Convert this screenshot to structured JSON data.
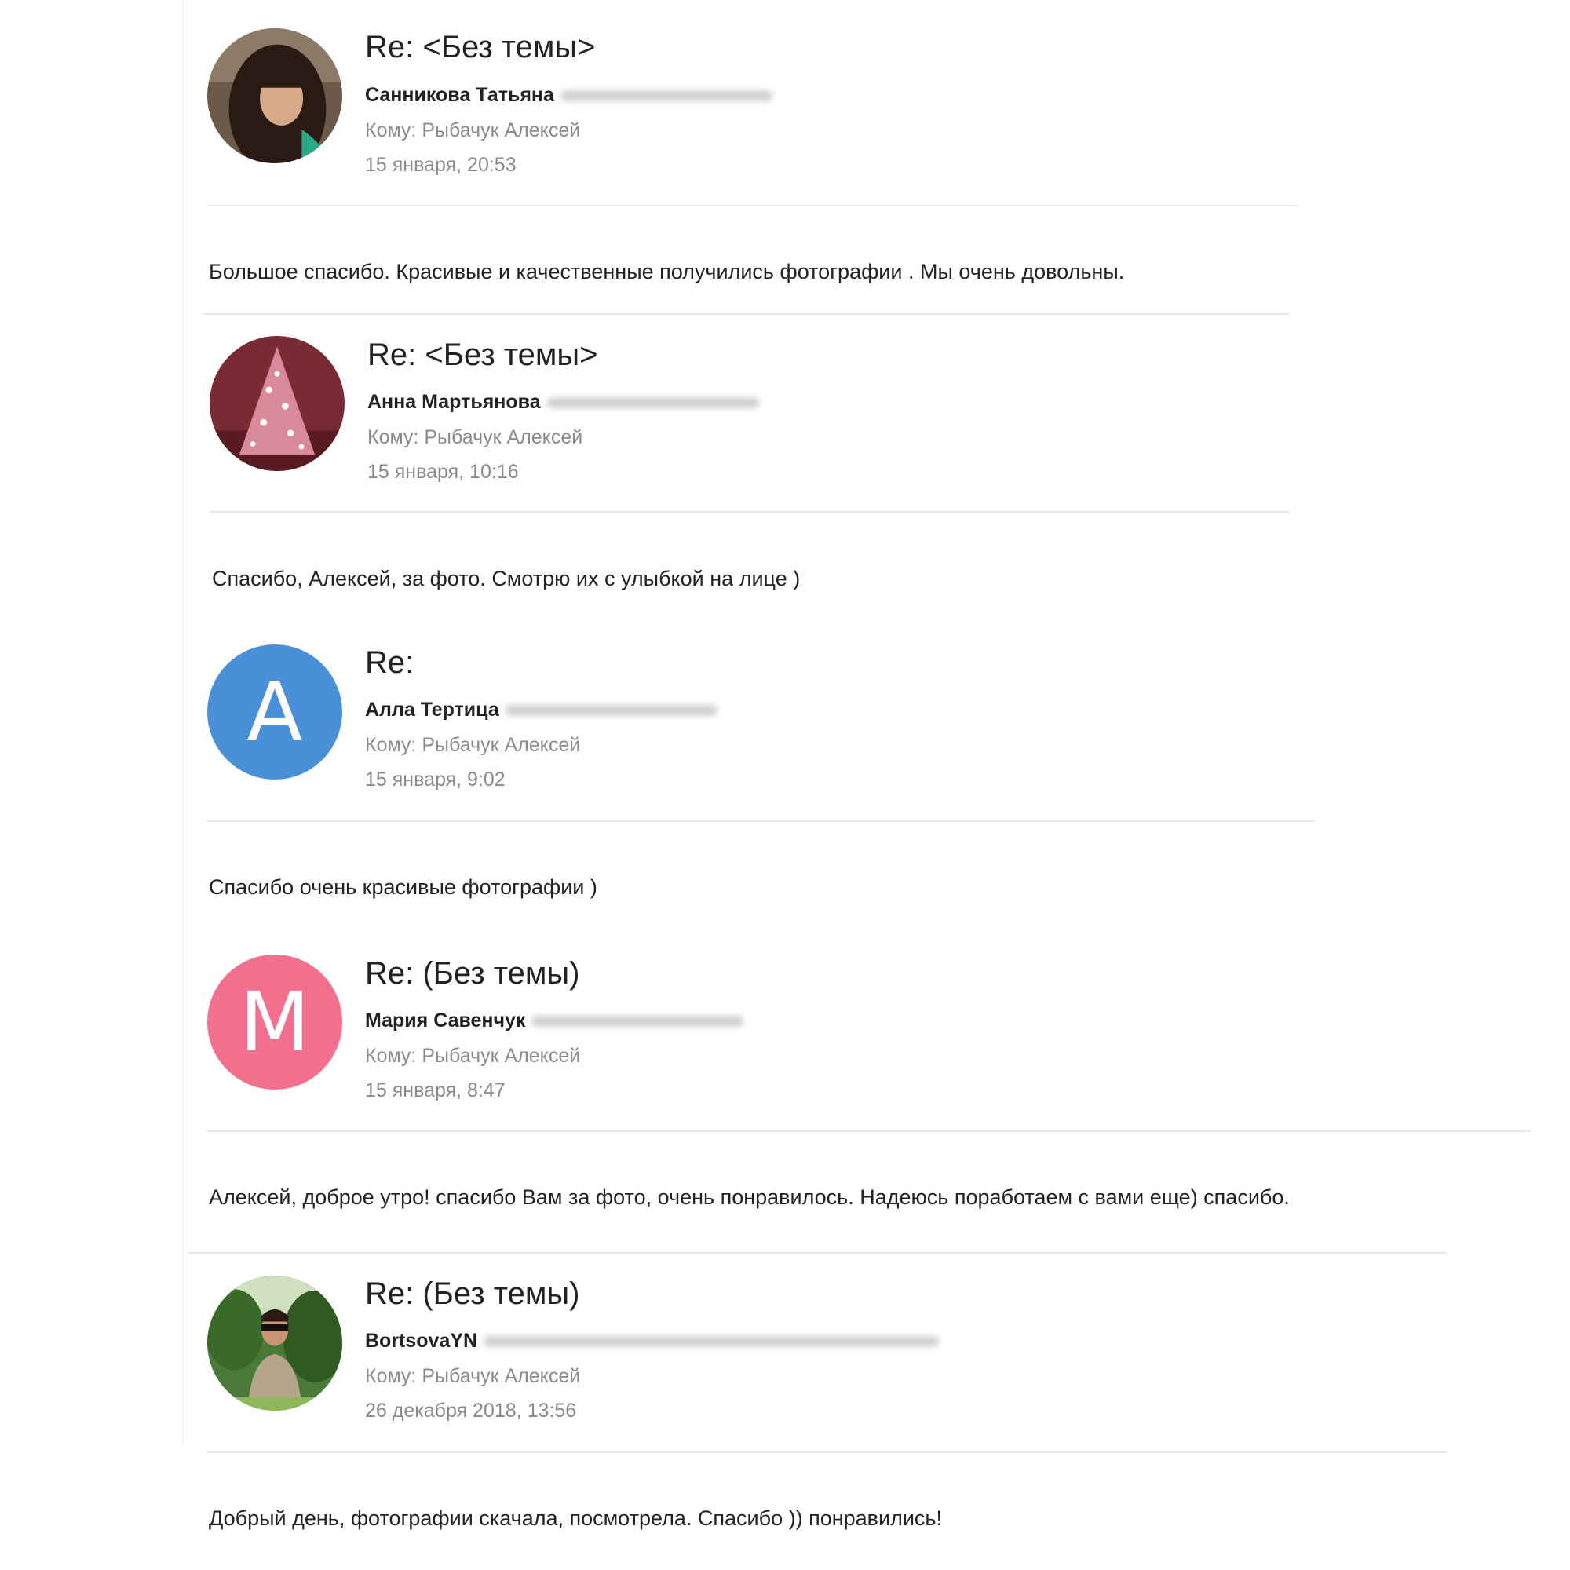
{
  "messages": [
    {
      "subject": "Re: <Без темы>",
      "sender": "Санникова Татьяна",
      "to": "Кому: Рыбачук Алексей",
      "date": "15 января, 20:53",
      "body": "Большое спасибо. Красивые и качественные получились фотографии . Мы очень довольны.",
      "avatar": "photo-woman-dark-hair"
    },
    {
      "subject": "Re: <Без темы>",
      "sender": "Анна Мартьянова",
      "to": "Кому: Рыбачук Алексей",
      "date": "15 января, 10:16",
      "body": "Спасибо, Алексей, за фото. Смотрю их с улыбкой на лице )",
      "avatar": "photo-christmas-tree"
    },
    {
      "subject": "Re:",
      "sender": "Алла Тертица",
      "to": "Кому: Рыбачук Алексей",
      "date": "15 января, 9:02",
      "body": "Спасибо очень красивые фотографии )",
      "avatar_letter": "A",
      "avatar_color": "#4a90d9"
    },
    {
      "subject": "Re: (Без темы)",
      "sender": "Мария Савенчук",
      "to": "Кому: Рыбачук Алексей",
      "date": "15 января, 8:47",
      "body": "Алексей, доброе утро! спасибо Вам за фото, очень понравилось. Надеюсь поработаем с вами еще) спасибо.",
      "avatar_letter": "M",
      "avatar_color": "#f2708e"
    },
    {
      "subject": "Re: (Без темы)",
      "sender": "BortsovaYN",
      "to": "Кому: Рыбачук Алексей",
      "date": "26 декабря 2018, 13:56",
      "body": "Добрый день, фотографии скачала, посмотрела. Спасибо )) понравились!",
      "avatar": "photo-woman-garden"
    }
  ]
}
